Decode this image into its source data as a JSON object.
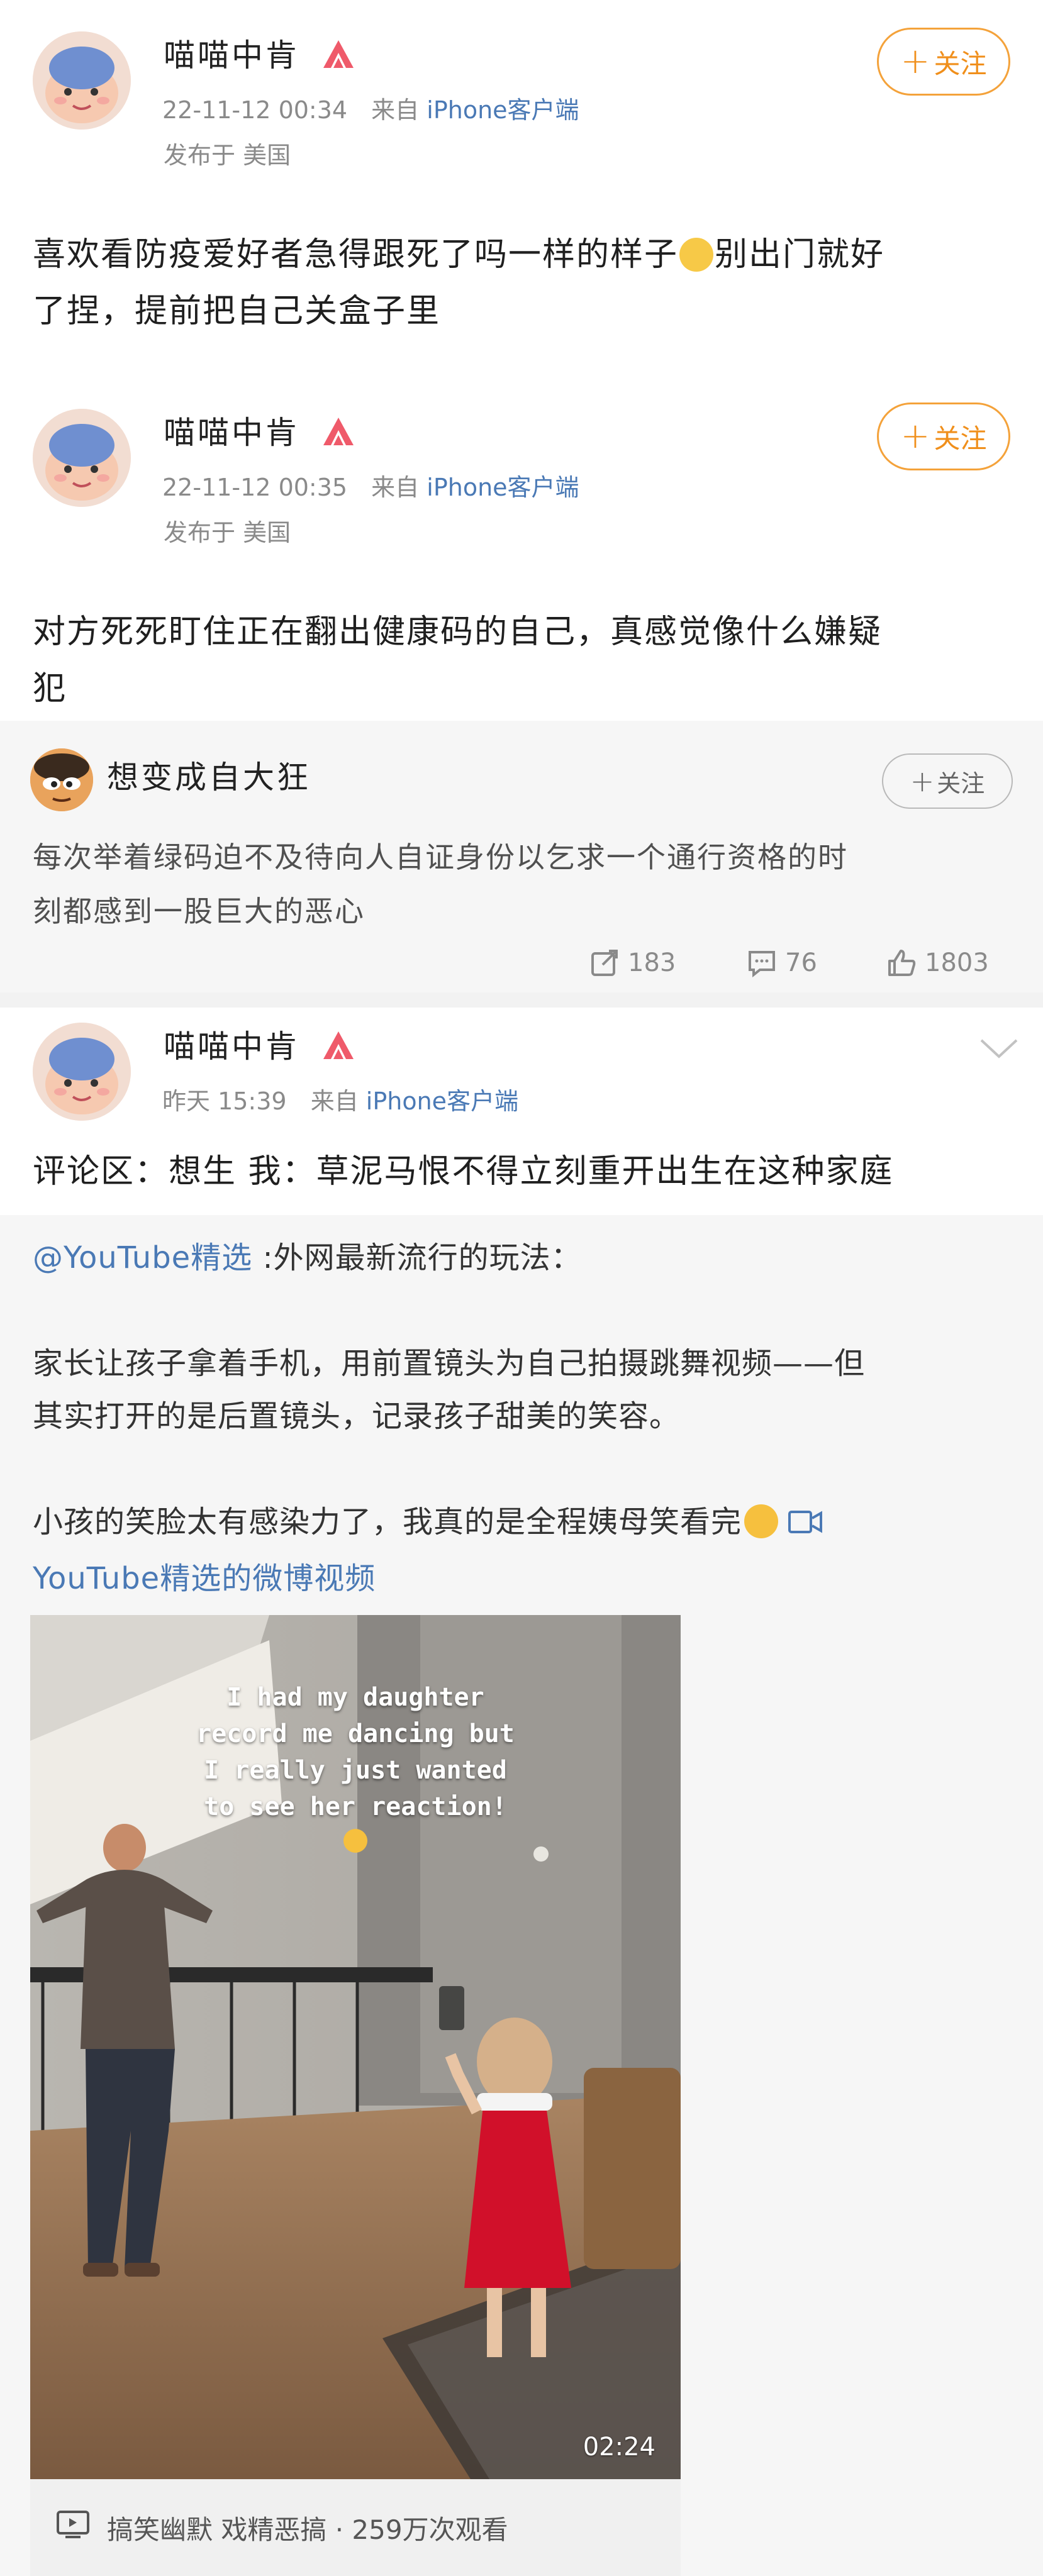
{
  "posts": [
    {
      "username": "喵喵中肯",
      "time": "22-11-12 00:34",
      "source_prefix": "来自",
      "source": "iPhone客户端",
      "location": "发布于 美国",
      "follow_label": "关注",
      "text_line1": "喜欢看防疫爱好者急得跟死了吗一样的样子",
      "text_after_emoji": "别出门就好",
      "text_line2": "了捏，提前把自己关盒子里"
    },
    {
      "username": "喵喵中肯",
      "time": "22-11-12 00:35",
      "source_prefix": "来自",
      "source": "iPhone客户端",
      "location": "发布于 美国",
      "follow_label": "关注",
      "text_line1": "对方死死盯住正在翻出健康码的自己，真感觉像什么嫌疑",
      "text_line2": "犯"
    }
  ],
  "repost": {
    "username": "想变成自大狂",
    "follow_label": "关注",
    "text_line1": "每次举着绿码迫不及待向人自证身份以乞求一个通行资格的时",
    "text_line2": "刻都感到一股巨大的恶心",
    "repost_count": "183",
    "comment_count": "76",
    "like_count": "1803"
  },
  "post3": {
    "username": "喵喵中肯",
    "time": "昨天 15:39",
    "source_prefix": "来自",
    "source": "iPhone客户端",
    "text": "评论区：想生 我：草泥马恨不得立刻重开出生在这种家庭"
  },
  "quoted": {
    "mention": "@YouTube精选",
    "mention_suffix": " :外网最新流行的玩法：",
    "para2_line1": "家长让孩子拿着手机，用前置镜头为自己拍摄跳舞视频——但",
    "para2_line2": "其实打开的是后置镜头，记录孩子甜美的笑容。",
    "para3_line1": "小孩的笑脸太有感染力了，我真的是全程姨母笑看完",
    "video_link": "YouTube精选的微博视频",
    "video_overlay_line1": "I had my daughter",
    "video_overlay_line2": "record me dancing but",
    "video_overlay_line3": "I really just wanted",
    "video_overlay_line4": "to see her reaction!",
    "duration": "02:24",
    "video_caption": "搞笑幽默 戏精恶搞 · 259万次观看"
  },
  "colors": {
    "follow_orange": "#f08f1b",
    "link_blue": "#4a79b5",
    "meta_grey": "#8a8a8a",
    "panel_grey": "#f6f6f6"
  }
}
